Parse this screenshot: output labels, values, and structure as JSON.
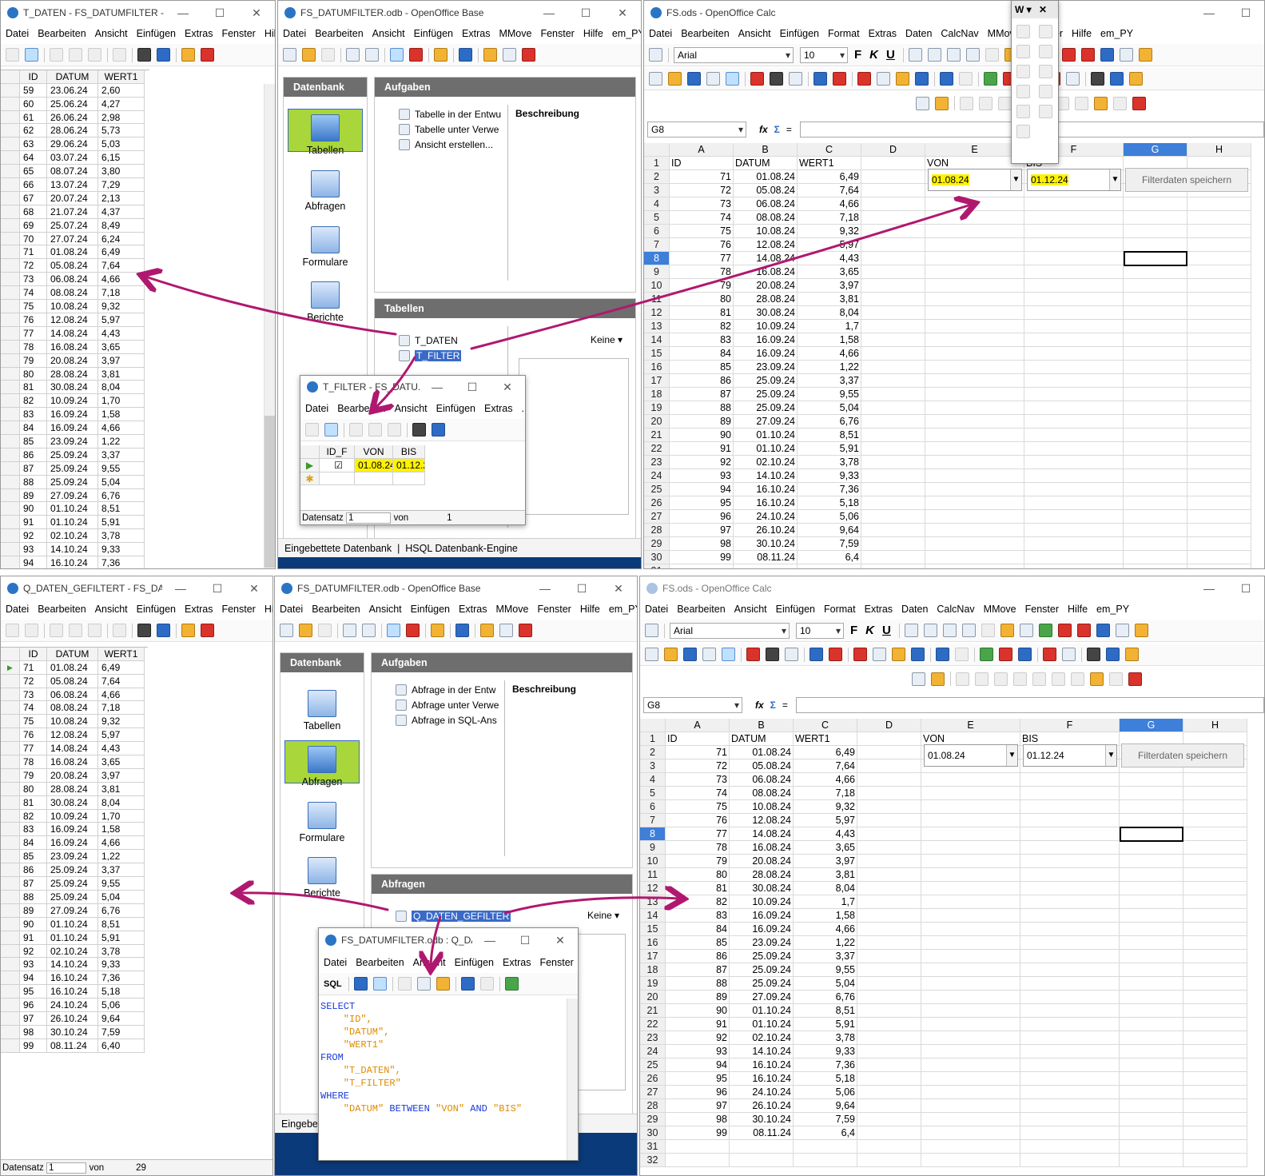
{
  "win_tdaten": {
    "title": "T_DATEN - FS_DATUMFILTER - O...",
    "menu": [
      "Datei",
      "Bearbeiten",
      "Ansicht",
      "Einfügen",
      "Extras",
      "Fenster",
      "Hilfe"
    ],
    "headers": [
      "ID",
      "DATUM",
      "WERT1"
    ],
    "rows": [
      [
        "59",
        "23.06.24",
        "2,60"
      ],
      [
        "60",
        "25.06.24",
        "4,27"
      ],
      [
        "61",
        "26.06.24",
        "2,98"
      ],
      [
        "62",
        "28.06.24",
        "5,73"
      ],
      [
        "63",
        "29.06.24",
        "5,03"
      ],
      [
        "64",
        "03.07.24",
        "6,15"
      ],
      [
        "65",
        "08.07.24",
        "3,80"
      ],
      [
        "66",
        "13.07.24",
        "7,29"
      ],
      [
        "67",
        "20.07.24",
        "2,13"
      ],
      [
        "68",
        "21.07.24",
        "4,37"
      ],
      [
        "69",
        "25.07.24",
        "8,49"
      ],
      [
        "70",
        "27.07.24",
        "6,24"
      ],
      [
        "71",
        "01.08.24",
        "6,49"
      ],
      [
        "72",
        "05.08.24",
        "7,64"
      ],
      [
        "73",
        "06.08.24",
        "4,66"
      ],
      [
        "74",
        "08.08.24",
        "7,18"
      ],
      [
        "75",
        "10.08.24",
        "9,32"
      ],
      [
        "76",
        "12.08.24",
        "5,97"
      ],
      [
        "77",
        "14.08.24",
        "4,43"
      ],
      [
        "78",
        "16.08.24",
        "3,65"
      ],
      [
        "79",
        "20.08.24",
        "3,97"
      ],
      [
        "80",
        "28.08.24",
        "3,81"
      ],
      [
        "81",
        "30.08.24",
        "8,04"
      ],
      [
        "82",
        "10.09.24",
        "1,70"
      ],
      [
        "83",
        "16.09.24",
        "1,58"
      ],
      [
        "84",
        "16.09.24",
        "4,66"
      ],
      [
        "85",
        "23.09.24",
        "1,22"
      ],
      [
        "86",
        "25.09.24",
        "3,37"
      ],
      [
        "87",
        "25.09.24",
        "9,55"
      ],
      [
        "88",
        "25.09.24",
        "5,04"
      ],
      [
        "89",
        "27.09.24",
        "6,76"
      ],
      [
        "90",
        "01.10.24",
        "8,51"
      ],
      [
        "91",
        "01.10.24",
        "5,91"
      ],
      [
        "92",
        "02.10.24",
        "3,78"
      ],
      [
        "93",
        "14.10.24",
        "9,33"
      ],
      [
        "94",
        "16.10.24",
        "7,36"
      ]
    ]
  },
  "win_qdaten": {
    "title": "Q_DATEN_GEFILTERT - FS_DATU...",
    "menu": [
      "Datei",
      "Bearbeiten",
      "Ansicht",
      "Einfügen",
      "Extras",
      "Fenster",
      "Hilfe"
    ],
    "headers": [
      "ID",
      "DATUM",
      "WERT1"
    ],
    "rows": [
      [
        "71",
        "01.08.24",
        "6,49"
      ],
      [
        "72",
        "05.08.24",
        "7,64"
      ],
      [
        "73",
        "06.08.24",
        "4,66"
      ],
      [
        "74",
        "08.08.24",
        "7,18"
      ],
      [
        "75",
        "10.08.24",
        "9,32"
      ],
      [
        "76",
        "12.08.24",
        "5,97"
      ],
      [
        "77",
        "14.08.24",
        "4,43"
      ],
      [
        "78",
        "16.08.24",
        "3,65"
      ],
      [
        "79",
        "20.08.24",
        "3,97"
      ],
      [
        "80",
        "28.08.24",
        "3,81"
      ],
      [
        "81",
        "30.08.24",
        "8,04"
      ],
      [
        "82",
        "10.09.24",
        "1,70"
      ],
      [
        "83",
        "16.09.24",
        "1,58"
      ],
      [
        "84",
        "16.09.24",
        "4,66"
      ],
      [
        "85",
        "23.09.24",
        "1,22"
      ],
      [
        "86",
        "25.09.24",
        "3,37"
      ],
      [
        "87",
        "25.09.24",
        "9,55"
      ],
      [
        "88",
        "25.09.24",
        "5,04"
      ],
      [
        "89",
        "27.09.24",
        "6,76"
      ],
      [
        "90",
        "01.10.24",
        "8,51"
      ],
      [
        "91",
        "01.10.24",
        "5,91"
      ],
      [
        "92",
        "02.10.24",
        "3,78"
      ],
      [
        "93",
        "14.10.24",
        "9,33"
      ],
      [
        "94",
        "16.10.24",
        "7,36"
      ],
      [
        "95",
        "16.10.24",
        "5,18"
      ],
      [
        "96",
        "24.10.24",
        "5,06"
      ],
      [
        "97",
        "26.10.24",
        "9,64"
      ],
      [
        "98",
        "30.10.24",
        "7,59"
      ],
      [
        "99",
        "08.11.24",
        "6,40"
      ]
    ],
    "status_label": "Datensatz",
    "status_value": "1",
    "status_of": "von",
    "status_total": "29"
  },
  "base_top": {
    "title": "FS_DATUMFILTER.odb - OpenOffice Base",
    "menu": [
      "Datei",
      "Bearbeiten",
      "Ansicht",
      "Einfügen",
      "Extras",
      "MMove",
      "Fenster",
      "Hilfe",
      "em_PY"
    ],
    "db_header": "Datenbank",
    "db_items": [
      "Tabellen",
      "Abfragen",
      "Formulare",
      "Berichte"
    ],
    "tasks_header": "Aufgaben",
    "tasks": [
      "Tabelle in der Entwu",
      "Tabelle unter Verwe",
      "Ansicht erstellen..."
    ],
    "desc_label": "Beschreibung",
    "list_header": "Tabellen",
    "list_items": [
      "T_DATEN",
      "T_FILTER"
    ],
    "preview": "Keine",
    "status": [
      "Eingebettete Datenbank",
      "HSQL Datenbank-Engine"
    ]
  },
  "base_bottom": {
    "title": "FS_DATUMFILTER.odb - OpenOffice Base",
    "menu": [
      "Datei",
      "Bearbeiten",
      "Ansicht",
      "Einfügen",
      "Extras",
      "MMove",
      "Fenster",
      "Hilfe",
      "em_PY"
    ],
    "db_header": "Datenbank",
    "db_items": [
      "Tabellen",
      "Abfragen",
      "Formulare",
      "Berichte"
    ],
    "tasks_header": "Aufgaben",
    "tasks": [
      "Abfrage in der Entw",
      "Abfrage unter Verwe",
      "Abfrage in SQL-Ans"
    ],
    "desc_label": "Beschreibung",
    "list_header": "Abfragen",
    "list_items": [
      "Q_DATEN_GEFILTER"
    ],
    "preview": "Keine",
    "status_partial": "Eingebe"
  },
  "tfilter": {
    "title": "T_FILTER - FS_DATU...",
    "menu": [
      "Datei",
      "Bearbeiten",
      "Ansicht",
      "Einfügen",
      "Extras",
      "...r"
    ],
    "headers": [
      "ID_F",
      "VON",
      "BIS"
    ],
    "von": "01.08.24",
    "bis": "01.12.2",
    "status_label": "Datensatz",
    "status_value": "1",
    "status_of": "von",
    "status_total": "1"
  },
  "sqlwin": {
    "title": "FS_DATUMFILTER.odb : Q_DA...",
    "menu": [
      "Datei",
      "Bearbeiten",
      "Ansicht",
      "Einfügen",
      "Extras",
      "Fenster",
      "...e"
    ],
    "sql_label": "SQL",
    "sql_lines": [
      {
        "k": "SELECT",
        "s": ""
      },
      {
        "k": "",
        "s": "    \"ID\","
      },
      {
        "k": "",
        "s": "    \"DATUM\","
      },
      {
        "k": "",
        "s": "    \"WERT1\""
      },
      {
        "k": "FROM",
        "s": ""
      },
      {
        "k": "",
        "s": "    \"T_DATEN\","
      },
      {
        "k": "",
        "s": "    \"T_FILTER\""
      },
      {
        "k": "WHERE",
        "s": ""
      }
    ],
    "where_a": "    \"DATUM\"",
    "where_b": "BETWEEN",
    "where_c": "\"VON\"",
    "where_d": "AND",
    "where_e": "\"BIS\""
  },
  "calc_top": {
    "title": "FS.ods - OpenOffice Calc",
    "menu": [
      "Datei",
      "Bearbeiten",
      "Ansicht",
      "Einfügen",
      "Format",
      "Extras",
      "Daten",
      "CalcNav",
      "MMove",
      "Fenster",
      "Hilfe",
      "em_PY"
    ],
    "font": "Arial",
    "size": "10",
    "cellref": "G8",
    "cols": [
      "A",
      "B",
      "C",
      "D",
      "E",
      "F",
      "G",
      "H"
    ],
    "headers": [
      "ID",
      "DATUM",
      "WERT1"
    ],
    "von_label": "VON",
    "bis_label": "BIS",
    "von": "01.08.24",
    "bis": "01.12.24",
    "button": "Filterdaten speichern",
    "float_title": "W"
  },
  "calc_bottom": {
    "title": "FS.ods - OpenOffice Calc",
    "menu": [
      "Datei",
      "Bearbeiten",
      "Ansicht",
      "Einfügen",
      "Format",
      "Extras",
      "Daten",
      "CalcNav",
      "MMove",
      "Fenster",
      "Hilfe",
      "em_PY"
    ],
    "font": "Arial",
    "size": "10",
    "cellref": "G8",
    "cols": [
      "A",
      "B",
      "C",
      "D",
      "E",
      "F",
      "G",
      "H"
    ],
    "headers": [
      "ID",
      "DATUM",
      "WERT1"
    ],
    "von_label": "VON",
    "bis_label": "BIS",
    "von": "01.08.24",
    "bis": "01.12.24",
    "button": "Filterdaten speichern"
  },
  "calc_rows": [
    [
      "71",
      "01.08.24",
      "6,49"
    ],
    [
      "72",
      "05.08.24",
      "7,64"
    ],
    [
      "73",
      "06.08.24",
      "4,66"
    ],
    [
      "74",
      "08.08.24",
      "7,18"
    ],
    [
      "75",
      "10.08.24",
      "9,32"
    ],
    [
      "76",
      "12.08.24",
      "5,97"
    ],
    [
      "77",
      "14.08.24",
      "4,43"
    ],
    [
      "78",
      "16.08.24",
      "3,65"
    ],
    [
      "79",
      "20.08.24",
      "3,97"
    ],
    [
      "80",
      "28.08.24",
      "3,81"
    ],
    [
      "81",
      "30.08.24",
      "8,04"
    ],
    [
      "82",
      "10.09.24",
      "1,7"
    ],
    [
      "83",
      "16.09.24",
      "1,58"
    ],
    [
      "84",
      "16.09.24",
      "4,66"
    ],
    [
      "85",
      "23.09.24",
      "1,22"
    ],
    [
      "86",
      "25.09.24",
      "3,37"
    ],
    [
      "87",
      "25.09.24",
      "9,55"
    ],
    [
      "88",
      "25.09.24",
      "5,04"
    ],
    [
      "89",
      "27.09.24",
      "6,76"
    ],
    [
      "90",
      "01.10.24",
      "8,51"
    ],
    [
      "91",
      "01.10.24",
      "5,91"
    ],
    [
      "92",
      "02.10.24",
      "3,78"
    ],
    [
      "93",
      "14.10.24",
      "9,33"
    ],
    [
      "94",
      "16.10.24",
      "7,36"
    ],
    [
      "95",
      "16.10.24",
      "5,18"
    ],
    [
      "96",
      "24.10.24",
      "5,06"
    ],
    [
      "97",
      "26.10.24",
      "9,64"
    ],
    [
      "98",
      "30.10.24",
      "7,59"
    ],
    [
      "99",
      "08.11.24",
      "6,4"
    ]
  ],
  "colors": {
    "accent": "#a9d63a",
    "highlight": "#fff200",
    "arrow": "#b0186f",
    "select": "#3a6ac8"
  }
}
